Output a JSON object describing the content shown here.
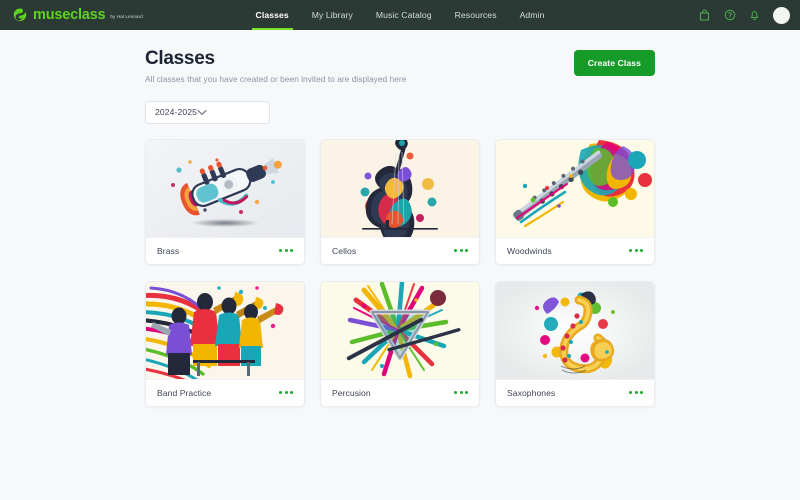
{
  "brand": {
    "name": "museclass",
    "tagline": "by Hal Leonard",
    "logo_icon": "museclass-swirl-logo",
    "accent_green": "#5cd321"
  },
  "topnav": {
    "items": [
      {
        "label": "Classes",
        "active": true
      },
      {
        "label": "My Library",
        "active": false
      },
      {
        "label": "Music Catalog",
        "active": false
      },
      {
        "label": "Resources",
        "active": false
      },
      {
        "label": "Admin",
        "active": false
      }
    ],
    "actions": [
      {
        "icon": "shopping-bag-icon"
      },
      {
        "icon": "help-circle-icon"
      },
      {
        "icon": "bell-icon"
      },
      {
        "icon": "avatar"
      }
    ],
    "bar_color": "#2c3a35",
    "active_underline_color": "#7ee024"
  },
  "header": {
    "title": "Classes",
    "subtitle": "All classes that you have created or been invited to are displayed here",
    "create_button": "Create Class",
    "create_button_color": "#169b28"
  },
  "filters": {
    "school_year": {
      "value": "2024-2025",
      "icon": "chevron-down-icon"
    }
  },
  "classes": [
    {
      "name": "Brass",
      "art": "trumpet",
      "bg": "#eef0f2",
      "menu_icon": "more-options-icon"
    },
    {
      "name": "Cellos",
      "art": "cello",
      "bg": "#fbf4e6",
      "menu_icon": "more-options-icon"
    },
    {
      "name": "Woodwinds",
      "art": "flute",
      "bg": "#fdfbe8",
      "menu_icon": "more-options-icon"
    },
    {
      "name": "Band Practice",
      "art": "band",
      "bg": "#fbf6ec",
      "menu_icon": "more-options-icon"
    },
    {
      "name": "Percusion",
      "art": "triangle",
      "bg": "#fcfbe9",
      "menu_icon": "more-options-icon"
    },
    {
      "name": "Saxophones",
      "art": "saxophone",
      "bg": "#eef1f0",
      "menu_icon": "more-options-icon"
    }
  ],
  "theme": {
    "page_background": "#f7f8fa",
    "card_background": "#ffffff",
    "menu_dot_color": "#1faa34"
  }
}
